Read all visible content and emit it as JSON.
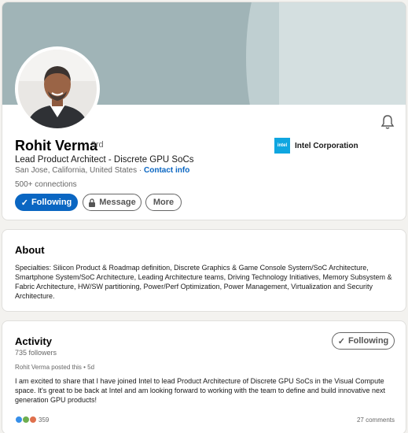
{
  "profile": {
    "name": "Rohit Verma",
    "degree": "· 3rd",
    "headline": "Lead Product Architect - Discrete GPU SoCs",
    "location": "San Jose, California, United States",
    "location_separator": "·",
    "contact_label": "Contact info",
    "connections": "500+ connections",
    "company_logo_text": "intel",
    "company": "Intel Corporation",
    "following_label": "Following",
    "message_label": "Message",
    "more_label": "More",
    "accent_color": "#0a66c2"
  },
  "about": {
    "title": "About",
    "text": "Specialties: Silicon Product & Roadmap definition, Discrete Graphics & Game Console System/SoC Architecture, Smartphone System/SoC Architecture, Leading Architecture teams, Driving Technology Initiatives, Memory Subsystem & Fabric Architecture, HW/SW partitioning, Power/Perf Optimization, Power Management, Virtualization and Security Architecture."
  },
  "activity": {
    "title": "Activity",
    "followers": "735 followers",
    "following_label": "Following",
    "post_meta": "Rohit Verma posted this • 5d",
    "post_text": "I am excited to share that I have joined Intel to lead Product Architecture of Discrete GPU SoCs in the Visual Compute space. It's great to be back at Intel and am looking forward to working with the team to define and build innovative next generation GPU products!",
    "reactions_count": "359",
    "comments": "27 comments",
    "reaction_icons": [
      "like-icon",
      "celebrate-icon",
      "love-icon"
    ]
  }
}
